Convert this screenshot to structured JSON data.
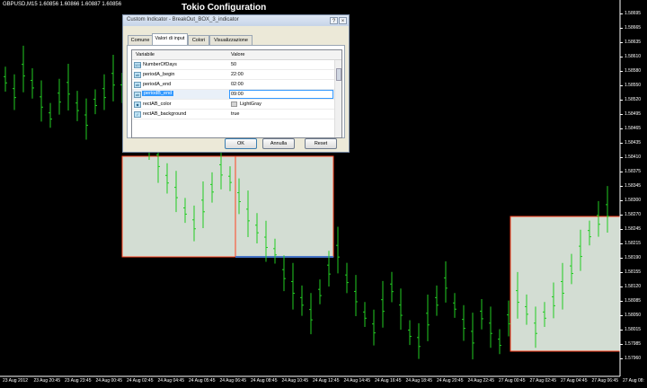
{
  "symbol_info": "GBPUSD,M15 1.60856 1.60866 1.60887 1.60856",
  "app_title": "Tokio Configuration",
  "price_axis": [
    "1.58695",
    "1.58665",
    "1.58635",
    "1.58610",
    "1.58580",
    "1.58550",
    "1.58520",
    "1.58495",
    "1.58465",
    "1.58435",
    "1.58410",
    "1.58375",
    "1.58345",
    "1.58300",
    "1.58270",
    "1.58245",
    "1.58215",
    "1.58190",
    "1.58155",
    "1.58120",
    "1.58085",
    "1.58050",
    "1.58015",
    "1.57985",
    "1.57960"
  ],
  "time_axis": [
    "23 Aug 2012",
    "23 Aug 20:45",
    "23 Aug 23:45",
    "24 Aug 00:45",
    "24 Aug 02:45",
    "24 Aug 04:45",
    "24 Aug 05:45",
    "24 Aug 06:45",
    "24 Aug 08:45",
    "24 Aug 10:45",
    "24 Aug 12:45",
    "24 Aug 14:45",
    "24 Aug 16:45",
    "24 Aug 18:45",
    "24 Aug 20:45",
    "24 Aug 22:45",
    "27 Aug 00:45",
    "27 Aug 02:45",
    "27 Aug 04:45",
    "27 Aug 06:45",
    "27 Aug 08:"
  ],
  "chart_data": {
    "type": "bar",
    "ylim": [
      1.5794,
      1.5871
    ],
    "grid": false,
    "colors": {
      "background": "#000000",
      "bars": "#22cc22",
      "box_fill": "#d3ddd3",
      "box_border": "#ff4422",
      "box_bottom": "#4472c4"
    },
    "series": [
      {
        "values": [
          1.5858,
          1.5855,
          1.586,
          1.5857,
          1.5853,
          1.585,
          1.5854,
          1.5856,
          1.5852,
          1.5849,
          1.5853,
          1.5855,
          1.5858,
          1.5856,
          1.5852,
          1.5848,
          1.5844,
          1.584,
          1.5836,
          1.5833,
          1.5829,
          1.5826,
          1.583,
          1.5834,
          1.5838,
          1.5836,
          1.5832,
          1.5828,
          1.5825,
          1.5822,
          1.582,
          1.5815,
          1.5812,
          1.5809,
          1.5806,
          1.5811,
          1.5816,
          1.582,
          1.5814,
          1.581,
          1.5806,
          1.5803,
          1.5808,
          1.5812,
          1.5807,
          1.5802,
          1.58,
          1.5805,
          1.5809,
          1.5813,
          1.5808,
          1.5804,
          1.5801,
          1.5806,
          1.5803,
          1.58,
          1.5805,
          1.581,
          1.5807,
          1.5803,
          1.5806,
          1.5809,
          1.5812,
          1.5816,
          1.582,
          1.5824,
          1.5827,
          1.5829
        ]
      }
    ]
  },
  "dialog": {
    "title": "Custom Indicator - BreakOut_BOX_3_indicator",
    "tabs": [
      "Comune",
      "Valori di input",
      "Colori",
      "Visualizzazione"
    ],
    "columns": {
      "variable": "Variabile",
      "value": "Valore"
    },
    "rows": [
      {
        "name": "NumberOfDays",
        "value": "50"
      },
      {
        "name": "periodA_begin",
        "value": "22:00"
      },
      {
        "name": "periodA_end",
        "value": "02:00"
      },
      {
        "name": "periodB_end",
        "value": "09:00"
      },
      {
        "name": "rectAB_color",
        "value": "LightGray"
      },
      {
        "name": "rectAB_background",
        "value": "true"
      }
    ],
    "buttons": {
      "ok": "OK",
      "cancel": "Annulla",
      "reset": "Reset"
    }
  }
}
